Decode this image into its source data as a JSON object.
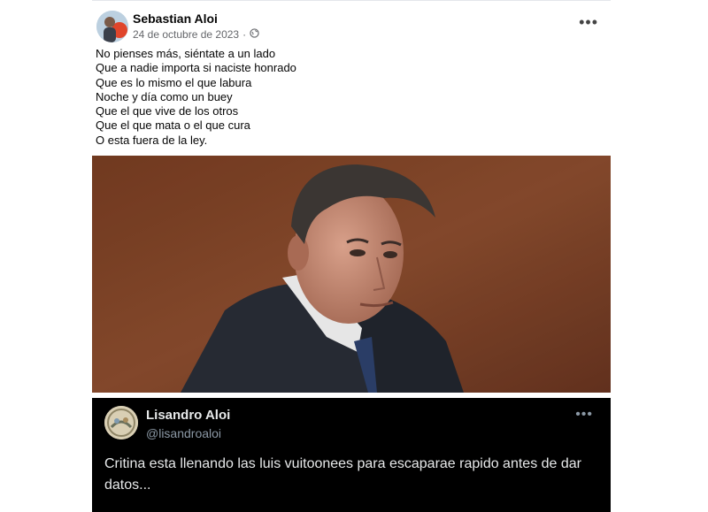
{
  "facebook_post": {
    "author": "Sebastian Aloi",
    "date": "24 de octubre de 2023",
    "date_separator": "·",
    "privacy_icon": "globe-icon",
    "menu_icon": "more-options-icon",
    "menu_glyph": "•••",
    "lines": [
      "No pienses más, siéntate a un lado",
      "Que a nadie importa si naciste honrado",
      "Que es lo mismo el que labura",
      "Noche y día como un buey",
      "Que el que vive de los otros",
      "Que el que mata o el que cura",
      "O esta fuera de la ley."
    ]
  },
  "photo": {
    "description_icon": "portrait-photo",
    "colors": {
      "background": "#8a4a2c",
      "suit": "#2b2f3a",
      "shirt": "#e8e8e8",
      "tie": "#2a3d66",
      "skin": "#c99278",
      "hair": "#3b3633"
    }
  },
  "tweet": {
    "name": "Lisandro Aloi",
    "handle": "@lisandroaloi",
    "menu_glyph": "•••",
    "text": "Critina esta llenando las luis vuitoonees para escaparae rapido antes de dar datos..."
  },
  "colors": {
    "tweet_bg": "#000000",
    "tweet_text": "#e7e9ea",
    "handle": "#8b98a5",
    "meta": "#65676b"
  }
}
